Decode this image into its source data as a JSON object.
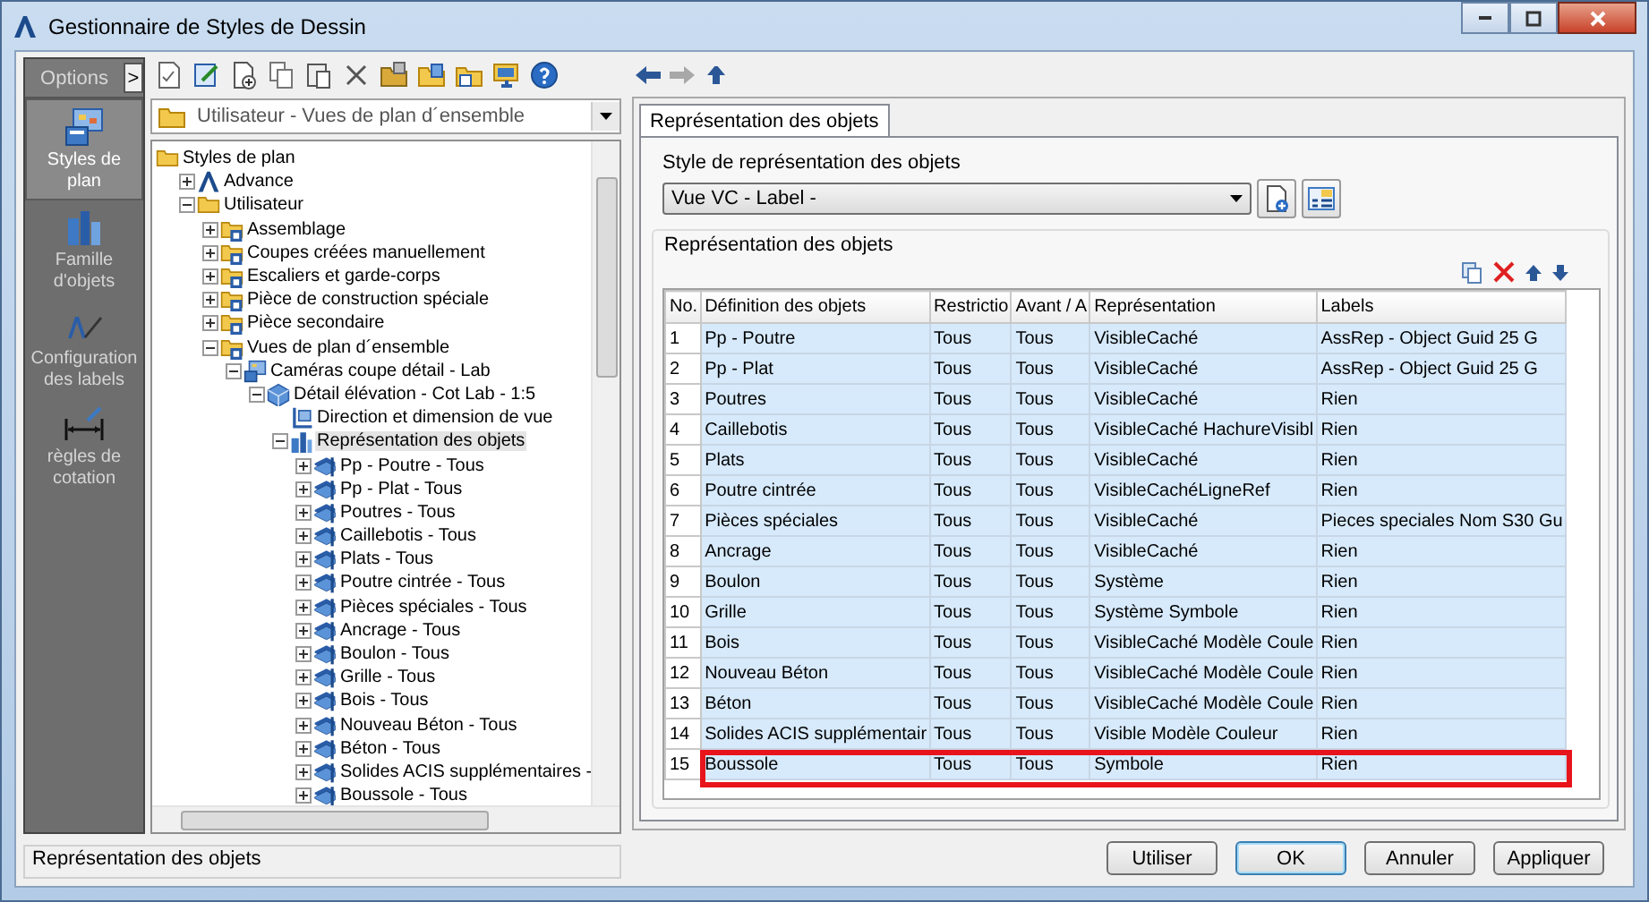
{
  "window": {
    "title": "Gestionnaire de Styles de Dessin"
  },
  "sidebar": {
    "header": "Options",
    "expand_button": ">",
    "items": [
      {
        "label": "Styles de plan",
        "kind": "plan",
        "selected": true
      },
      {
        "label": "Famille d'objets",
        "kind": "family",
        "selected": false
      },
      {
        "label": "Configuration des labels",
        "kind": "labels",
        "selected": false
      },
      {
        "label": "règles de cotation",
        "kind": "dimension",
        "selected": false
      }
    ]
  },
  "toolbar": {
    "buttons": [
      {
        "kind": "check"
      },
      {
        "kind": "edit"
      },
      {
        "kind": "new"
      },
      {
        "kind": "copy"
      },
      {
        "kind": "paste"
      },
      {
        "kind": "delete"
      },
      {
        "kind": "folder-import"
      },
      {
        "kind": "folder-export"
      },
      {
        "kind": "folder-doc"
      },
      {
        "kind": "monitor"
      },
      {
        "kind": "help"
      }
    ]
  },
  "nav": {
    "buttons": [
      {
        "kind": "back",
        "disabled": false
      },
      {
        "kind": "forward",
        "disabled": true
      },
      {
        "kind": "up",
        "disabled": false
      }
    ]
  },
  "path_dropdown": {
    "value": "Utilisateur - Vues de plan d´ensemble"
  },
  "tree": {
    "nodes": [
      {
        "label": "Styles de plan",
        "kind": "folder",
        "selected": false,
        "children": [
          {
            "label": "Advance",
            "kind": "logo",
            "expanded": false,
            "selected": false
          },
          {
            "label": "Utilisateur",
            "kind": "folder",
            "expanded": true,
            "selected": false,
            "children": [
              {
                "label": "Assemblage",
                "kind": "style-folder",
                "expanded": false,
                "selected": false
              },
              {
                "label": "Coupes créées manuellement",
                "kind": "style-folder",
                "expanded": false,
                "selected": false
              },
              {
                "label": "Escaliers et garde-corps",
                "kind": "style-folder",
                "expanded": false,
                "selected": false
              },
              {
                "label": "Pièce de construction spéciale",
                "kind": "style-folder",
                "expanded": false,
                "selected": false
              },
              {
                "label": "Pièce secondaire",
                "kind": "style-folder",
                "expanded": false,
                "selected": false
              },
              {
                "label": "Vues de plan d´ensemble",
                "kind": "style-folder",
                "expanded": true,
                "selected": false,
                "children": [
                  {
                    "label": "Caméras coupe détail - Lab",
                    "kind": "camera",
                    "expanded": true,
                    "selected": false,
                    "children": [
                      {
                        "label": "Détail élévation - Cot Lab - 1:5",
                        "kind": "view",
                        "expanded": true,
                        "selected": false,
                        "children": [
                          {
                            "label": "Direction et dimension de vue",
                            "kind": "direction",
                            "selected": false
                          },
                          {
                            "label": "Représentation des objets",
                            "kind": "rep",
                            "expanded": true,
                            "selected": true,
                            "children": [
                              {
                                "label": "Pp - Poutre - Tous",
                                "kind": "item",
                                "expanded": false,
                                "selected": false
                              },
                              {
                                "label": "Pp - Plat - Tous",
                                "kind": "item",
                                "expanded": false,
                                "selected": false
                              },
                              {
                                "label": "Poutres - Tous",
                                "kind": "item",
                                "expanded": false,
                                "selected": false
                              },
                              {
                                "label": "Caillebotis - Tous",
                                "kind": "item",
                                "expanded": false,
                                "selected": false
                              },
                              {
                                "label": "Plats - Tous",
                                "kind": "item",
                                "expanded": false,
                                "selected": false
                              },
                              {
                                "label": "Poutre cintrée - Tous",
                                "kind": "item",
                                "expanded": false,
                                "selected": false
                              },
                              {
                                "label": "Pièces spéciales - Tous",
                                "kind": "item",
                                "expanded": false,
                                "selected": false
                              },
                              {
                                "label": "Ancrage - Tous",
                                "kind": "item",
                                "expanded": false,
                                "selected": false
                              },
                              {
                                "label": "Boulon - Tous",
                                "kind": "item",
                                "expanded": false,
                                "selected": false
                              },
                              {
                                "label": "Grille - Tous",
                                "kind": "item",
                                "expanded": false,
                                "selected": false
                              },
                              {
                                "label": "Bois - Tous",
                                "kind": "item",
                                "expanded": false,
                                "selected": false
                              },
                              {
                                "label": "Nouveau Béton - Tous",
                                "kind": "item",
                                "expanded": false,
                                "selected": false
                              },
                              {
                                "label": "Béton - Tous",
                                "kind": "item",
                                "expanded": false,
                                "selected": false
                              },
                              {
                                "label": "Solides ACIS supplémentaires -",
                                "kind": "item",
                                "expanded": false,
                                "selected": false
                              },
                              {
                                "label": "Boussole - Tous",
                                "kind": "item",
                                "expanded": false,
                                "selected": false
                              }
                            ]
                          }
                        ]
                      }
                    ]
                  }
                ]
              }
            ]
          }
        ]
      }
    ]
  },
  "tabs": [
    {
      "label": "Représentation des objets",
      "selected": true
    }
  ],
  "style_field": {
    "label": "Style de représentation des objets",
    "value": "Vue VC - Label -"
  },
  "group": {
    "title": "Représentation des objets"
  },
  "table": {
    "columns": [
      "No.",
      "Définition des objets",
      "Restrictio",
      "Avant / A",
      "Représentation",
      "Labels"
    ],
    "rows": [
      {
        "cells": [
          "1",
          "Pp - Poutre",
          "Tous",
          "Tous",
          "VisibleCaché",
          "AssRep - Object Guid 25 G"
        ],
        "outlined": false
      },
      {
        "cells": [
          "2",
          "Pp - Plat",
          "Tous",
          "Tous",
          "VisibleCaché",
          "AssRep - Object Guid 25 G"
        ],
        "outlined": false
      },
      {
        "cells": [
          "3",
          "Poutres",
          "Tous",
          "Tous",
          "VisibleCaché",
          "Rien"
        ],
        "outlined": false
      },
      {
        "cells": [
          "4",
          "Caillebotis",
          "Tous",
          "Tous",
          "VisibleCaché HachureVisibl",
          "Rien"
        ],
        "outlined": false
      },
      {
        "cells": [
          "5",
          "Plats",
          "Tous",
          "Tous",
          "VisibleCaché",
          "Rien"
        ],
        "outlined": false
      },
      {
        "cells": [
          "6",
          "Poutre cintrée",
          "Tous",
          "Tous",
          "VisibleCachéLigneRef",
          "Rien"
        ],
        "outlined": false
      },
      {
        "cells": [
          "7",
          "Pièces spéciales",
          "Tous",
          "Tous",
          "VisibleCaché",
          "Pieces speciales Nom S30 Gu"
        ],
        "outlined": false
      },
      {
        "cells": [
          "8",
          "Ancrage",
          "Tous",
          "Tous",
          "VisibleCaché",
          "Rien"
        ],
        "outlined": false
      },
      {
        "cells": [
          "9",
          "Boulon",
          "Tous",
          "Tous",
          "Système",
          "Rien"
        ],
        "outlined": false
      },
      {
        "cells": [
          "10",
          "Grille",
          "Tous",
          "Tous",
          "Système Symbole",
          "Rien"
        ],
        "outlined": false
      },
      {
        "cells": [
          "11",
          "Bois",
          "Tous",
          "Tous",
          "VisibleCaché Modèle Coule",
          "Rien"
        ],
        "outlined": false
      },
      {
        "cells": [
          "12",
          "Nouveau Béton",
          "Tous",
          "Tous",
          "VisibleCaché Modèle Coule",
          "Rien"
        ],
        "outlined": false
      },
      {
        "cells": [
          "13",
          "Béton",
          "Tous",
          "Tous",
          "VisibleCaché Modèle Coule",
          "Rien"
        ],
        "outlined": false
      },
      {
        "cells": [
          "14",
          "Solides ACIS supplémentair",
          "Tous",
          "Tous",
          "Visible Modèle Couleur",
          "Rien"
        ],
        "outlined": false
      },
      {
        "cells": [
          "15",
          "Boussole",
          "Tous",
          "Tous",
          "Symbole",
          "Rien"
        ],
        "outlined": true
      }
    ]
  },
  "status_bar": {
    "text": "Représentation des objets"
  },
  "buttons": [
    {
      "label": "Utiliser",
      "focused": false
    },
    {
      "label": "OK",
      "focused": true
    },
    {
      "label": "Annuler",
      "focused": false
    },
    {
      "label": "Appliquer",
      "focused": false
    }
  ]
}
